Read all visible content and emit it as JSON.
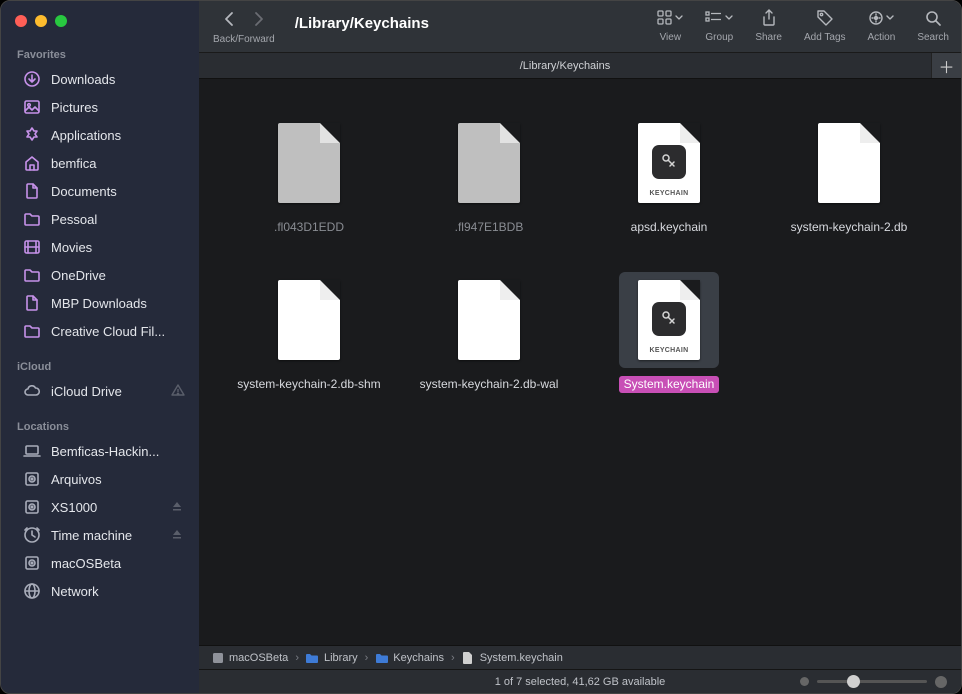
{
  "traffic_lights": [
    "close",
    "minimize",
    "zoom"
  ],
  "toolbar": {
    "nav_label": "Back/Forward",
    "title": "/Library/Keychains",
    "view_label": "View",
    "group_label": "Group",
    "share_label": "Share",
    "tags_label": "Add Tags",
    "action_label": "Action",
    "search_label": "Search"
  },
  "tab": {
    "title": "/Library/Keychains"
  },
  "sidebar": {
    "sections": [
      {
        "label": "Favorites",
        "items": [
          {
            "icon": "download",
            "label": "Downloads"
          },
          {
            "icon": "pictures",
            "label": "Pictures"
          },
          {
            "icon": "apps",
            "label": "Applications"
          },
          {
            "icon": "home",
            "label": "bemfica"
          },
          {
            "icon": "doc",
            "label": "Documents"
          },
          {
            "icon": "folder",
            "label": "Pessoal"
          },
          {
            "icon": "movies",
            "label": "Movies"
          },
          {
            "icon": "folder",
            "label": "OneDrive"
          },
          {
            "icon": "doc",
            "label": "MBP Downloads"
          },
          {
            "icon": "folder",
            "label": "Creative Cloud Fil..."
          }
        ]
      },
      {
        "label": "iCloud",
        "items": [
          {
            "icon": "cloud",
            "label": "iCloud Drive",
            "warn": true
          }
        ]
      },
      {
        "label": "Locations",
        "items": [
          {
            "icon": "laptop",
            "label": "Bemficas-Hackin..."
          },
          {
            "icon": "disk",
            "label": "Arquivos"
          },
          {
            "icon": "disk",
            "label": "XS1000",
            "eject": true
          },
          {
            "icon": "time",
            "label": "Time machine",
            "eject": true
          },
          {
            "icon": "disk",
            "label": "macOSBeta"
          },
          {
            "icon": "globe",
            "label": "Network"
          }
        ]
      }
    ]
  },
  "files": [
    {
      "name": ".fl043D1EDD",
      "type": "hidden",
      "selected": false
    },
    {
      "name": ".fl947E1BDB",
      "type": "hidden",
      "selected": false
    },
    {
      "name": "apsd.keychain",
      "type": "keychain",
      "selected": false
    },
    {
      "name": "system-keychain-2.db",
      "type": "plain",
      "selected": false
    },
    {
      "name": "system-keychain-2.db-shm",
      "type": "plain",
      "selected": false
    },
    {
      "name": "system-keychain-2.db-wal",
      "type": "plain",
      "selected": false
    },
    {
      "name": "System.keychain",
      "type": "keychain",
      "selected": true
    }
  ],
  "pathbar": [
    {
      "icon": "disk",
      "label": "macOSBeta"
    },
    {
      "icon": "folder",
      "label": "Library"
    },
    {
      "icon": "folder",
      "label": "Keychains"
    },
    {
      "icon": "file",
      "label": "System.keychain"
    }
  ],
  "status": "1 of 7 selected, 41,62 GB available",
  "keychain_badge_text": "KEYCHAIN"
}
